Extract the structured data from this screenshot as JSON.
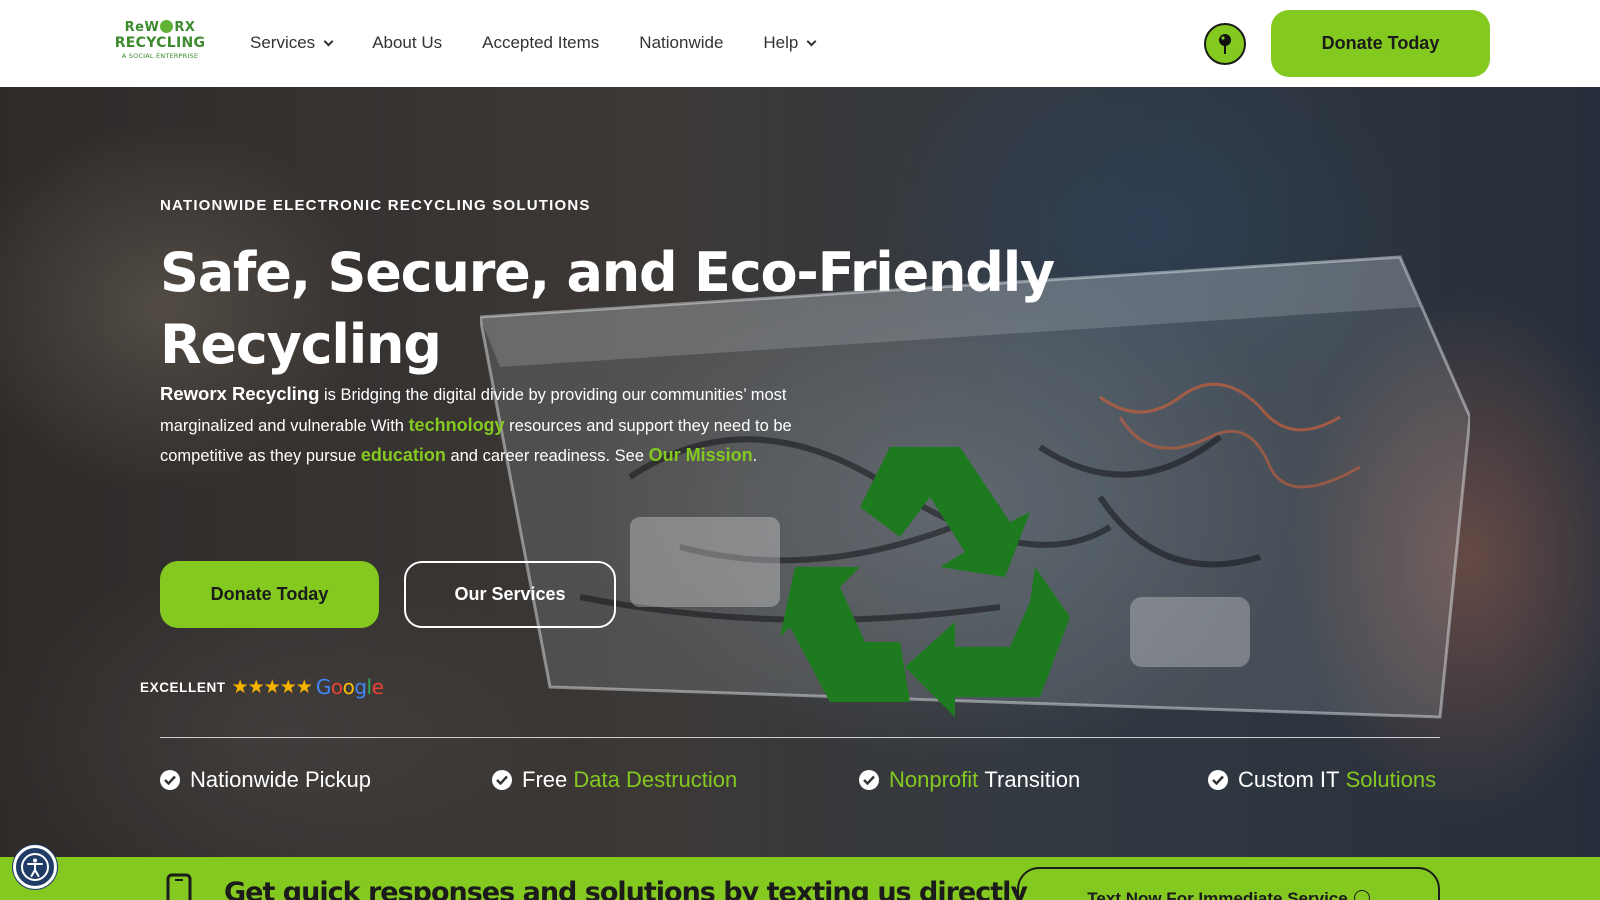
{
  "logo": {
    "line1_a": "ReW",
    "line1_b": "RX",
    "line2": "RECYCLING",
    "line3": "A SOCIAL ENTERPRISE"
  },
  "nav": {
    "items": [
      {
        "label": "Services",
        "has_dropdown": true
      },
      {
        "label": "About Us",
        "has_dropdown": false
      },
      {
        "label": "Accepted Items",
        "has_dropdown": false
      },
      {
        "label": "Nationwide",
        "has_dropdown": false
      },
      {
        "label": "Help",
        "has_dropdown": true
      }
    ],
    "location_icon": "map-pin-icon",
    "donate_label": "Donate Today"
  },
  "hero": {
    "eyebrow": "NATIONWIDE ELECTRONIC RECYCLING SOLUTIONS",
    "headline_line1": "Safe, Secure, and Eco-Friendly",
    "headline_line2": "Recycling",
    "intro": {
      "brand": "Reworx Recycling",
      "part1": " is Bridging the digital divide by providing our communities’ most marginalized and vulnerable With ",
      "link_technology": "technology",
      "part2": " resources and support they need to be competitive as they pursue ",
      "link_education": "education",
      "part3": " and career readiness. See ",
      "link_mission": "Our Mission",
      "part4": "."
    },
    "primary_button": "Donate Today",
    "secondary_button": "Our Services",
    "rating": {
      "label": "EXCELLENT",
      "stars": "★★★★★",
      "stars_value": 5,
      "google": [
        "G",
        "o",
        "o",
        "g",
        "l",
        "e"
      ]
    },
    "features": [
      {
        "plain_before": "Nationwide Pickup",
        "highlight": "",
        "plain_after": ""
      },
      {
        "plain_before": "Free ",
        "highlight": "Data Destruction",
        "plain_after": ""
      },
      {
        "plain_before": "",
        "highlight": "Nonprofit",
        "plain_after": " Transition"
      },
      {
        "plain_before": "Custom IT ",
        "highlight": "Solutions",
        "plain_after": ""
      }
    ]
  },
  "text_bar": {
    "title": "Get quick responses and solutions by texting us directly",
    "button": "Text Now For Immediate Service",
    "icon": "mobile-phone-icon"
  },
  "accessibility": {
    "icon": "accessibility-icon"
  },
  "colors": {
    "accent_green": "#84c91f",
    "logo_green": "#3d8b2e",
    "recycle_green": "#1e7a1e",
    "text_dark": "#1b1b1b",
    "a11y_blue": "#1f3b66",
    "google": [
      "#4285F4",
      "#EA4335",
      "#FBBC05",
      "#4285F4",
      "#34A853",
      "#EA4335"
    ]
  }
}
